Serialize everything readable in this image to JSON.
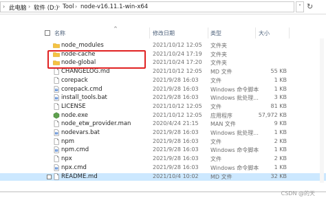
{
  "address_bar": {
    "segments": [
      "此电脑",
      "软件 (D:)",
      "Tool",
      "node-v16.11.1-win-x64"
    ]
  },
  "columns": {
    "name": "名称",
    "date": "修改日期",
    "type": "类型",
    "size": "大小"
  },
  "files": [
    {
      "name": "node_modules",
      "date": "2021/10/12 12:05",
      "type": "文件夹",
      "size": "",
      "icon": "folder-icon"
    },
    {
      "name": "node-cache",
      "date": "2021/10/24 17:19",
      "type": "文件夹",
      "size": "",
      "icon": "folder-icon"
    },
    {
      "name": "node-global",
      "date": "2021/10/24 17:20",
      "type": "文件夹",
      "size": "",
      "icon": "folder-icon"
    },
    {
      "name": "CHANGELOG.md",
      "date": "2021/10/12 12:05",
      "type": "MD 文件",
      "size": "55 KB",
      "icon": "file-icon"
    },
    {
      "name": "corepack",
      "date": "2021/9/28 16:03",
      "type": "文件",
      "size": "1 KB",
      "icon": "file-icon"
    },
    {
      "name": "corepack.cmd",
      "date": "2021/9/28 16:03",
      "type": "Windows 命令脚本",
      "size": "1 KB",
      "icon": "script-icon"
    },
    {
      "name": "install_tools.bat",
      "date": "2021/9/28 16:03",
      "type": "Windows 批处理...",
      "size": "3 KB",
      "icon": "script-icon"
    },
    {
      "name": "LICENSE",
      "date": "2021/10/12 12:05",
      "type": "文件",
      "size": "81 KB",
      "icon": "file-icon"
    },
    {
      "name": "node.exe",
      "date": "2021/10/12 12:05",
      "type": "应用程序",
      "size": "57,972 KB",
      "icon": "node-app-icon"
    },
    {
      "name": "node_etw_provider.man",
      "date": "2020/4/24 21:15",
      "type": "MAN 文件",
      "size": "9 KB",
      "icon": "file-icon"
    },
    {
      "name": "nodevars.bat",
      "date": "2021/9/28 16:03",
      "type": "Windows 批处理...",
      "size": "1 KB",
      "icon": "script-icon"
    },
    {
      "name": "npm",
      "date": "2021/9/28 16:03",
      "type": "文件",
      "size": "2 KB",
      "icon": "file-icon"
    },
    {
      "name": "npm.cmd",
      "date": "2021/9/28 16:03",
      "type": "Windows 命令脚本",
      "size": "1 KB",
      "icon": "script-icon"
    },
    {
      "name": "npx",
      "date": "2021/9/28 16:03",
      "type": "文件",
      "size": "2 KB",
      "icon": "file-icon"
    },
    {
      "name": "npx.cmd",
      "date": "2021/9/28 16:03",
      "type": "Windows 命令脚本",
      "size": "1 KB",
      "icon": "script-icon"
    },
    {
      "name": "README.md",
      "date": "2021/10/4 10:02",
      "type": "MD 文件",
      "size": "32 KB",
      "icon": "file-icon",
      "selected": true
    }
  ],
  "watermark": "CSDN @的天"
}
